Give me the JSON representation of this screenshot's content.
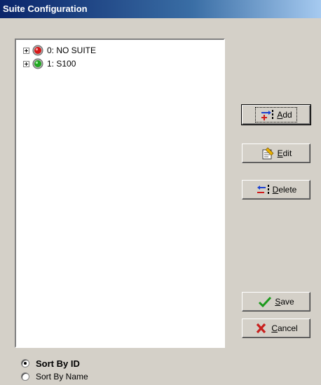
{
  "window": {
    "title": "Suite Configuration"
  },
  "tree": {
    "items": [
      {
        "label": "0: NO SUITE",
        "status": "red",
        "status_color": "#d81818"
      },
      {
        "label": "1: S100",
        "status": "green",
        "status_color": "#22a822"
      }
    ]
  },
  "buttons": {
    "add": {
      "label_first": "A",
      "label_rest": "dd",
      "icon": "add-icon"
    },
    "edit": {
      "label_first": "E",
      "label_rest": "dit",
      "icon": "edit-icon"
    },
    "delete": {
      "label_first": "D",
      "label_rest": "elete",
      "icon": "delete-icon"
    },
    "save": {
      "label_first": "S",
      "label_rest": "ave",
      "icon": "checkmark-icon",
      "icon_color": "#1c9a1c"
    },
    "cancel": {
      "label_first": "C",
      "label_rest": "ancel",
      "icon": "x-icon",
      "icon_color": "#c8201e"
    }
  },
  "sort": {
    "selected": "id",
    "options": [
      {
        "id": "id",
        "label": "Sort By ID"
      },
      {
        "id": "name",
        "label": "Sort By Name"
      }
    ]
  }
}
